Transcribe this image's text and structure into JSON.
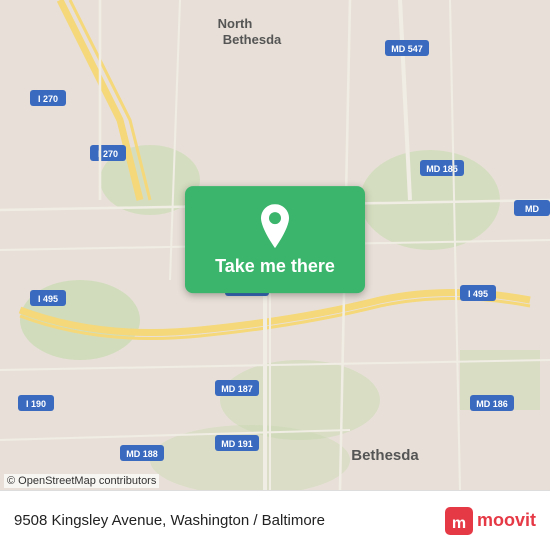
{
  "map": {
    "copyright": "© OpenStreetMap contributors",
    "background_color": "#e8e0d8"
  },
  "cta": {
    "label": "Take me there",
    "pin_icon": "location-pin"
  },
  "bottom_bar": {
    "address": "9508 Kingsley Avenue, Washington / Baltimore",
    "logo_text": "moovit"
  }
}
